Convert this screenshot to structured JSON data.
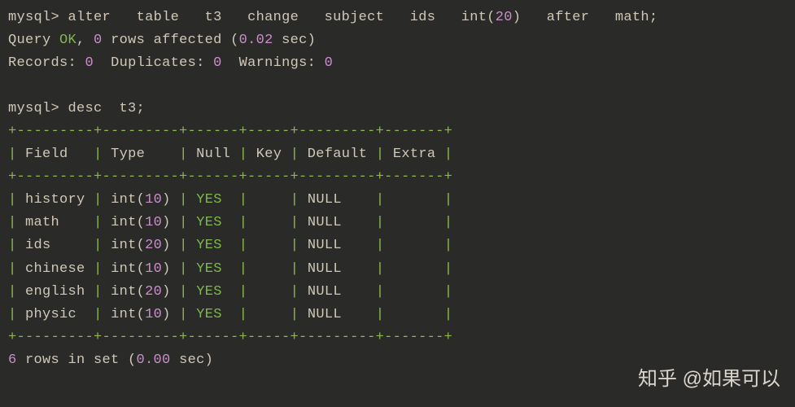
{
  "prompt1": "mysql>",
  "cmd1_parts": {
    "alter": "alter",
    "table": "table",
    "t3": "t3",
    "change": "change",
    "subject": "subject",
    "ids": "ids",
    "int": "int",
    "lp": "(",
    "twenty": "20",
    "rp": ")",
    "after": "after",
    "math": "math;"
  },
  "result1": {
    "prefix": "Query ",
    "ok": "OK",
    "mid": ", ",
    "zero1": "0",
    "rows": " rows affected (",
    "time": "0.02",
    "suffix": " sec)"
  },
  "result2": {
    "records": "Records",
    "colon1": ": ",
    "zero1": "0",
    "sp1": "  ",
    "dup": "Duplicates",
    "colon2": ": ",
    "zero2": "0",
    "sp2": "  ",
    "warn": "Warnings",
    "colon3": ": ",
    "zero3": "0"
  },
  "prompt2": "mysql>",
  "cmd2": " desc  t3;",
  "border": "+---------+---------+------+-----+---------+-------+",
  "header": {
    "c1": "Field",
    "c2": "Type",
    "c3": "Null",
    "c4": "Key",
    "c5": "Default",
    "c6": "Extra"
  },
  "rows": [
    {
      "field": "history",
      "type_base": "int",
      "type_num": "10",
      "null": "YES",
      "key": "",
      "default": "NULL",
      "extra": ""
    },
    {
      "field": "math",
      "type_base": "int",
      "type_num": "10",
      "null": "YES",
      "key": "",
      "default": "NULL",
      "extra": ""
    },
    {
      "field": "ids",
      "type_base": "int",
      "type_num": "20",
      "null": "YES",
      "key": "",
      "default": "NULL",
      "extra": ""
    },
    {
      "field": "chinese",
      "type_base": "int",
      "type_num": "10",
      "null": "YES",
      "key": "",
      "default": "NULL",
      "extra": ""
    },
    {
      "field": "english",
      "type_base": "int",
      "type_num": "20",
      "null": "YES",
      "key": "",
      "default": "NULL",
      "extra": ""
    },
    {
      "field": "physic",
      "type_base": "int",
      "type_num": "10",
      "null": "YES",
      "key": "",
      "default": "NULL",
      "extra": ""
    }
  ],
  "footer": {
    "prefix": "6",
    "rows_in": " rows in set (",
    "time": "0.00",
    "suffix": " sec)"
  },
  "watermark": "知乎 @如果可以"
}
